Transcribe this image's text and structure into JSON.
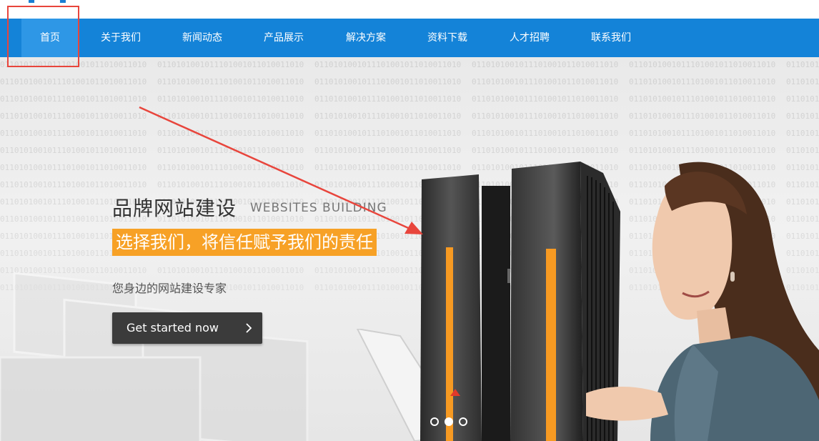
{
  "nav": {
    "items": [
      {
        "label": "首页",
        "active": true
      },
      {
        "label": "关于我们",
        "active": false
      },
      {
        "label": "新闻动态",
        "active": false
      },
      {
        "label": "产品展示",
        "active": false
      },
      {
        "label": "解决方案",
        "active": false
      },
      {
        "label": "资料下载",
        "active": false
      },
      {
        "label": "人才招聘",
        "active": false
      },
      {
        "label": "联系我们",
        "active": false
      }
    ]
  },
  "hero": {
    "title": "品牌网站建设",
    "title_en": "WEBSITES BUILDING",
    "highlight": "选择我们，将信任赋予我们的责任",
    "subtitle": "您身边的网站建设专家",
    "cta_label": "Get started now",
    "cta_icon": "chevron-right-icon"
  },
  "slider": {
    "total_slides": 3,
    "active_slide": 2
  },
  "colors": {
    "nav_bg": "#1483d8",
    "nav_active": "#2e97e6",
    "highlight": "#f7a126",
    "annotation": "#e8453c",
    "cta_bg": "#3b3b3b"
  }
}
